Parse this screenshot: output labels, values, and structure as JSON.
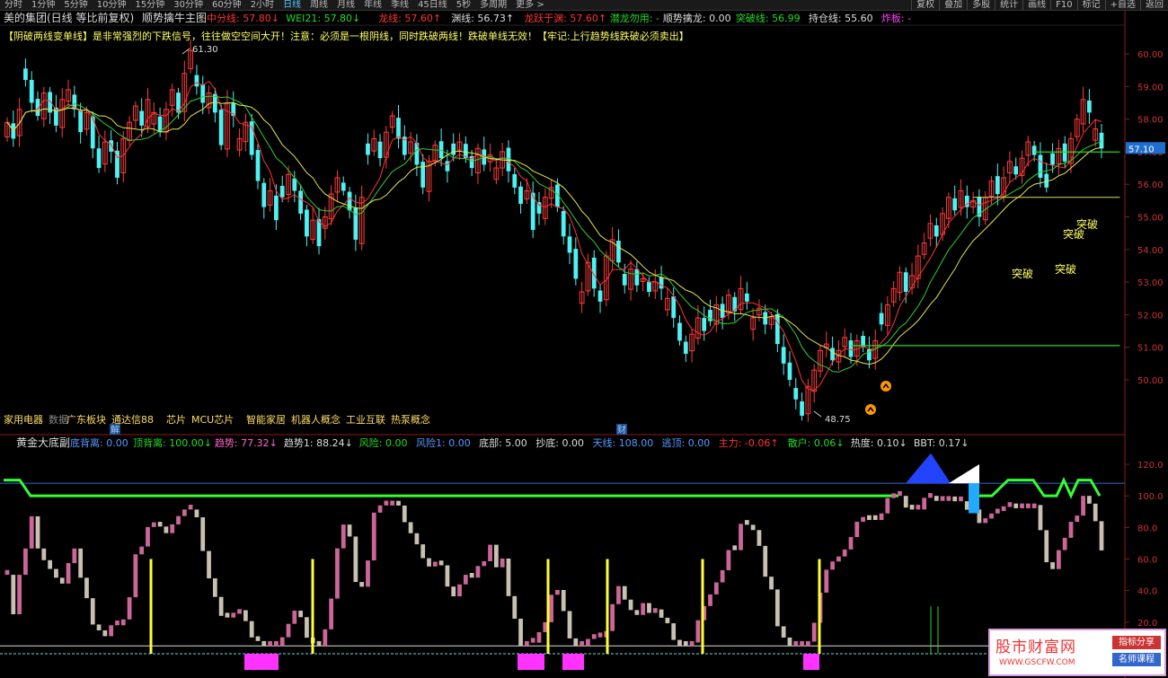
{
  "toolbar": {
    "periods": [
      "分时",
      "1分钟",
      "5分钟",
      "10分钟",
      "15分钟",
      "30分钟",
      "60分钟",
      "2小时",
      "日线",
      "周线",
      "月线",
      "年线",
      "季线",
      "45日线",
      "5秒",
      "多周期",
      "更多 >"
    ],
    "active_period": "日线",
    "right_buttons": [
      "复权",
      "叠加",
      "多股",
      "统计",
      "画线",
      "F10",
      "标记",
      "+自选",
      "返回"
    ]
  },
  "main_header": {
    "title": "美的集团(日线 等比前复权)",
    "indicator_name": "顺势擒牛主图",
    "items": [
      {
        "label": "中分线: 57.80",
        "arrow": "down",
        "color": "#ff3333"
      },
      {
        "label": "WEI21: 57.80",
        "arrow": "down",
        "color": "#22dd22"
      },
      {
        "label": "龙线: 57.60",
        "arrow": "up",
        "color": "#ff3333"
      },
      {
        "label": "渊线: 56.73",
        "arrow": "up",
        "color": "#dddddd"
      },
      {
        "label": "龙跃于渊: 57.60",
        "arrow": "up",
        "color": "#ff3333"
      },
      {
        "label": "潜龙勿用: -",
        "arrow": "",
        "color": "#22dd22"
      },
      {
        "label": "顺势擒龙: 0.00",
        "arrow": "",
        "color": "#dddddd"
      },
      {
        "label": "突破线: 56.99",
        "arrow": "",
        "color": "#22dd22"
      },
      {
        "label": "持仓线: 55.60",
        "arrow": "",
        "color": "#dddddd"
      },
      {
        "label": "炸板: -",
        "arrow": "",
        "color": "#ff44ff"
      }
    ],
    "notice": "【阴破两线变单线】是非常强烈的下跌信号，往往做空空间大开！注意：必须是一根阴线，同时跌破两线！跌破单线无效！【牢记:上行趋势线跌破必须卖出】"
  },
  "sub_header": {
    "indicator_name": "黄金大底副",
    "items": [
      {
        "label": "底背离: 0.00",
        "arrow": "",
        "color": "#5599ff"
      },
      {
        "label": "顶背离: 100.00",
        "arrow": "down",
        "color": "#22dd22"
      },
      {
        "label": "趋势: 77.32",
        "arrow": "down",
        "color": "#ff66cc"
      },
      {
        "label": "趋势1: 88.24",
        "arrow": "down",
        "color": "#dddddd"
      },
      {
        "label": "风险: 0.00",
        "arrow": "",
        "color": "#22dd22"
      },
      {
        "label": "风险1: 0.00",
        "arrow": "",
        "color": "#5599ff"
      },
      {
        "label": "底部: 5.00",
        "arrow": "",
        "color": "#dddddd"
      },
      {
        "label": "抄底: 0.00",
        "arrow": "",
        "color": "#dddddd"
      },
      {
        "label": "天线: 108.00",
        "arrow": "",
        "color": "#5599ff"
      },
      {
        "label": "逃顶: 0.00",
        "arrow": "",
        "color": "#5599ff"
      },
      {
        "label": "主力: -0.06",
        "arrow": "up",
        "color": "#ff3333"
      },
      {
        "label": "散户: 0.06",
        "arrow": "down",
        "color": "#22dd22"
      },
      {
        "label": "热度: 0.10",
        "arrow": "down",
        "color": "#dddddd"
      },
      {
        "label": "BBT: 0.17",
        "arrow": "down",
        "color": "#dddddd"
      }
    ]
  },
  "concepts": [
    "家用电器",
    "数据",
    "广东板块",
    "通达信88",
    "芯片",
    "MCU芯片",
    "智能家居",
    "机器人概念",
    "工业互联",
    "热泵概念"
  ],
  "concept_markers": [
    "解",
    "财"
  ],
  "price_panel": {
    "y_ticks": [
      60.0,
      59.0,
      58.0,
      57.0,
      56.0,
      55.0,
      54.0,
      53.0,
      52.0,
      51.0,
      50.0
    ],
    "current_price": "57.10",
    "high_label": "61.30",
    "low_label": "48.75",
    "breakout_labels": [
      "突破",
      "突破",
      "突破",
      "突破"
    ],
    "colors": {
      "up": "#ff3b3b",
      "down": "#4ef2f2",
      "ma_fast": "#ff3333",
      "ma_slow": "#e6e64d",
      "ma_mid": "#33cc33",
      "green_line": "#22dd22",
      "yellow_line": "#dddd66"
    }
  },
  "indicator_panel": {
    "y_ticks": [
      120.0,
      100.0,
      80.0,
      60.0,
      40.0,
      20.0
    ],
    "colors": {
      "bar_up": "#cc6699",
      "bar_down": "#c8c0b0",
      "signal": "#ffff33",
      "green": "#33ff33",
      "blue": "#3355ff",
      "magenta": "#ff33ff"
    }
  },
  "chart_data": {
    "type": "candlestick",
    "y_range": [
      48.0,
      61.5
    ],
    "notable_points": {
      "max": 61.3,
      "min": 48.75,
      "last": 57.1
    },
    "green_lines": [
      {
        "from_index": 138,
        "to_index": 182,
        "value": 51.05
      },
      {
        "from_index": 168,
        "to_index": 182,
        "value": 56.99
      }
    ],
    "yellow_line": {
      "from_index": 158,
      "to_index": 182,
      "value": 55.6
    },
    "close": [
      57.9,
      57.4,
      58.3,
      59.2,
      58.5,
      58.1,
      58.8,
      58.2,
      57.8,
      58.6,
      58.9,
      58.3,
      57.6,
      58.2,
      57.1,
      56.5,
      57.3,
      57.0,
      56.2,
      57.4,
      57.9,
      58.4,
      57.8,
      58.6,
      58.2,
      57.6,
      58.3,
      58.9,
      58.2,
      59.4,
      60.1,
      59.0,
      58.5,
      58.8,
      58.2,
      57.2,
      58.5,
      58.1,
      57.4,
      57.9,
      56.9,
      56.1,
      55.3,
      55.8,
      54.9,
      55.6,
      56.3,
      55.8,
      55.1,
      54.4,
      54.9,
      54.1,
      55.0,
      55.7,
      56.2,
      55.8,
      55.2,
      54.3,
      55.6,
      56.9,
      57.4,
      56.8,
      57.6,
      58.1,
      57.4,
      56.9,
      57.3,
      56.6,
      55.9,
      56.7,
      57.2,
      56.8,
      56.4,
      56.9,
      57.3,
      56.8,
      56.5,
      57.1,
      56.6,
      56.9,
      56.5,
      57.0,
      56.4,
      55.9,
      55.4,
      55.8,
      54.6,
      55.1,
      55.6,
      55.9,
      55.3,
      54.4,
      53.9,
      53.1,
      52.7,
      53.6,
      52.8,
      52.4,
      53.8,
      54.3,
      53.6,
      52.9,
      53.4,
      52.9,
      53.1,
      52.7,
      53.0,
      52.8,
      52.5,
      51.9,
      51.2,
      50.8,
      51.4,
      51.9,
      51.5,
      51.8,
      52.3,
      51.9,
      52.6,
      52.1,
      52.8,
      52.4,
      51.9,
      52.2,
      51.7,
      51.9,
      51.1,
      50.5,
      50.0,
      49.4,
      48.9,
      49.8,
      50.3,
      50.9,
      51.1,
      50.6,
      50.9,
      51.3,
      50.7,
      51.2,
      51.0,
      50.6,
      51.2,
      51.7,
      52.3,
      52.8,
      53.3,
      52.7,
      53.2,
      53.8,
      54.2,
      54.8,
      54.4,
      55.1,
      55.6,
      55.2,
      55.8,
      55.3,
      55.5,
      55.0,
      55.6,
      56.1,
      55.7,
      56.2,
      56.7,
      56.3,
      56.8,
      57.3,
      56.9,
      56.2,
      55.9,
      56.6,
      57.1,
      56.7,
      57.4,
      58.0,
      58.6,
      58.2,
      57.7,
      57.1
    ]
  }
}
